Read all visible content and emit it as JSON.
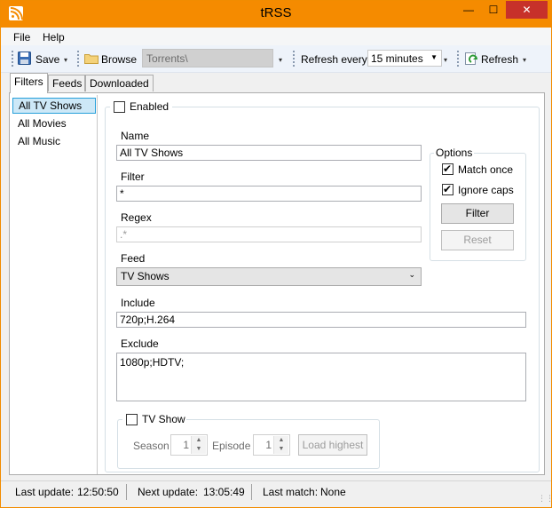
{
  "window": {
    "title": "tRSS",
    "minimize_glyph": "—",
    "maximize_glyph": "☐",
    "close_glyph": "✕",
    "accent_color": "#f58b00",
    "app_icon": "rss-icon"
  },
  "menu": {
    "file_label": "File",
    "help_label": "Help"
  },
  "toolbar": {
    "save_label": "Save",
    "browse_label": "Browse",
    "torrents_path": "Torrents\\",
    "refresh_every_label": "Refresh every",
    "refresh_interval": "15 minutes",
    "refresh_label": "Refresh",
    "dropdown_glyph": "▾"
  },
  "tabs": [
    {
      "label": "Filters",
      "active": true
    },
    {
      "label": "Feeds",
      "active": false
    },
    {
      "label": "Downloaded",
      "active": false
    }
  ],
  "filter_list": {
    "items": [
      {
        "label": "All TV Shows",
        "selected": true
      },
      {
        "label": "All Movies",
        "selected": false
      },
      {
        "label": "All Music",
        "selected": false
      }
    ]
  },
  "filter_editor": {
    "enabled_label": "Enabled",
    "enabled_checked": false,
    "name_label": "Name",
    "name_value": "All TV Shows",
    "filter_label": "Filter",
    "filter_value": "*",
    "regex_label": "Regex",
    "regex_value": ".*",
    "feed_label": "Feed",
    "feed_value": "TV Shows",
    "include_label": "Include",
    "include_value": "720p;H.264",
    "exclude_label": "Exclude",
    "exclude_value": "1080p;HDTV;",
    "options": {
      "group_label": "Options",
      "match_once_label": "Match once",
      "match_once_checked": true,
      "ignore_caps_label": "Ignore caps",
      "ignore_caps_checked": true,
      "filter_button": "Filter",
      "reset_button": "Reset"
    },
    "tv_show": {
      "group_label": "TV Show",
      "checked": false,
      "season_label": "Season",
      "season_value": "1",
      "episode_label": "Episode",
      "episode_value": "1",
      "load_highest_button": "Load highest"
    }
  },
  "status": {
    "last_update_label": "Last update:",
    "last_update_value": "12:50:50",
    "next_update_label": "Next update:",
    "next_update_value": "13:05:49",
    "last_match_label": "Last match:",
    "last_match_value": "None"
  }
}
